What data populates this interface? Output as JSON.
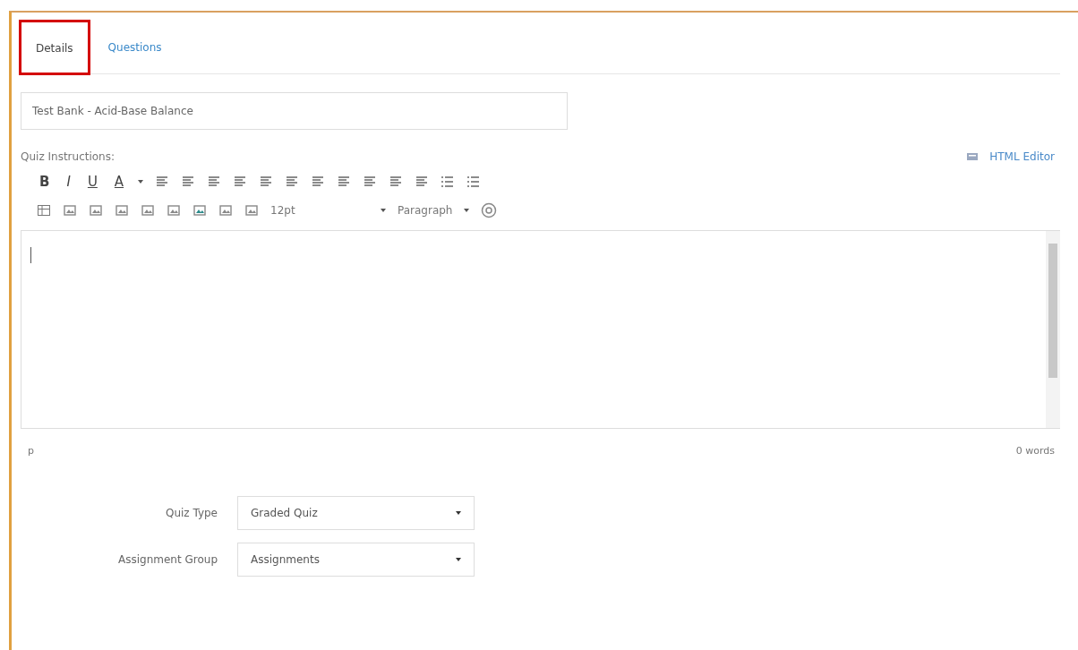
{
  "tabs": [
    {
      "label": "Details",
      "selected": true,
      "highlighted": true
    },
    {
      "label": "Questions",
      "selected": false,
      "highlighted": false
    }
  ],
  "quiz_title": {
    "value": "Test Bank - Acid-Base Balance"
  },
  "instructions": {
    "label": "Quiz Instructions:",
    "html_editor_link": "HTML Editor",
    "format_buttons": [
      "B",
      "I",
      "U",
      "A"
    ],
    "font_size": "12pt",
    "block_format": "Paragraph",
    "path": "p",
    "word_count": "0 words"
  },
  "settings": [
    {
      "label": "Quiz Type",
      "value": "Graded Quiz"
    },
    {
      "label": "Assignment Group",
      "value": "Assignments"
    }
  ]
}
